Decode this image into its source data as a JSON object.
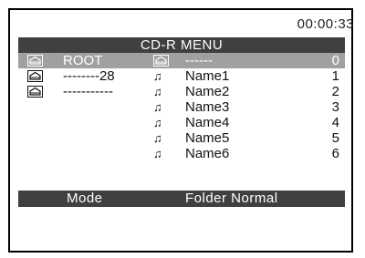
{
  "clock": "00:00:33",
  "title": "CD-R MENU",
  "folders": [
    {
      "name": "ROOT",
      "icon": "folder-icon",
      "selected": true
    },
    {
      "name": "--------28",
      "icon": "folder-icon",
      "selected": false
    },
    {
      "name": "-----------",
      "icon": "folder-icon",
      "selected": false
    }
  ],
  "tracks": [
    {
      "name": "------",
      "index": "0",
      "icon": "folder-icon"
    },
    {
      "name": "Name1",
      "index": "1",
      "icon": "music-note-icon"
    },
    {
      "name": "Name2",
      "index": "2",
      "icon": "music-note-icon"
    },
    {
      "name": "Name3",
      "index": "3",
      "icon": "music-note-icon"
    },
    {
      "name": "Name4",
      "index": "4",
      "icon": "music-note-icon"
    },
    {
      "name": "Name5",
      "index": "5",
      "icon": "music-note-icon"
    },
    {
      "name": "Name6",
      "index": "6",
      "icon": "music-note-icon"
    }
  ],
  "mode": {
    "label": "Mode",
    "value": "Folder Normal"
  },
  "colors": {
    "bar": "#404040",
    "selection": "#a0a0a0"
  }
}
